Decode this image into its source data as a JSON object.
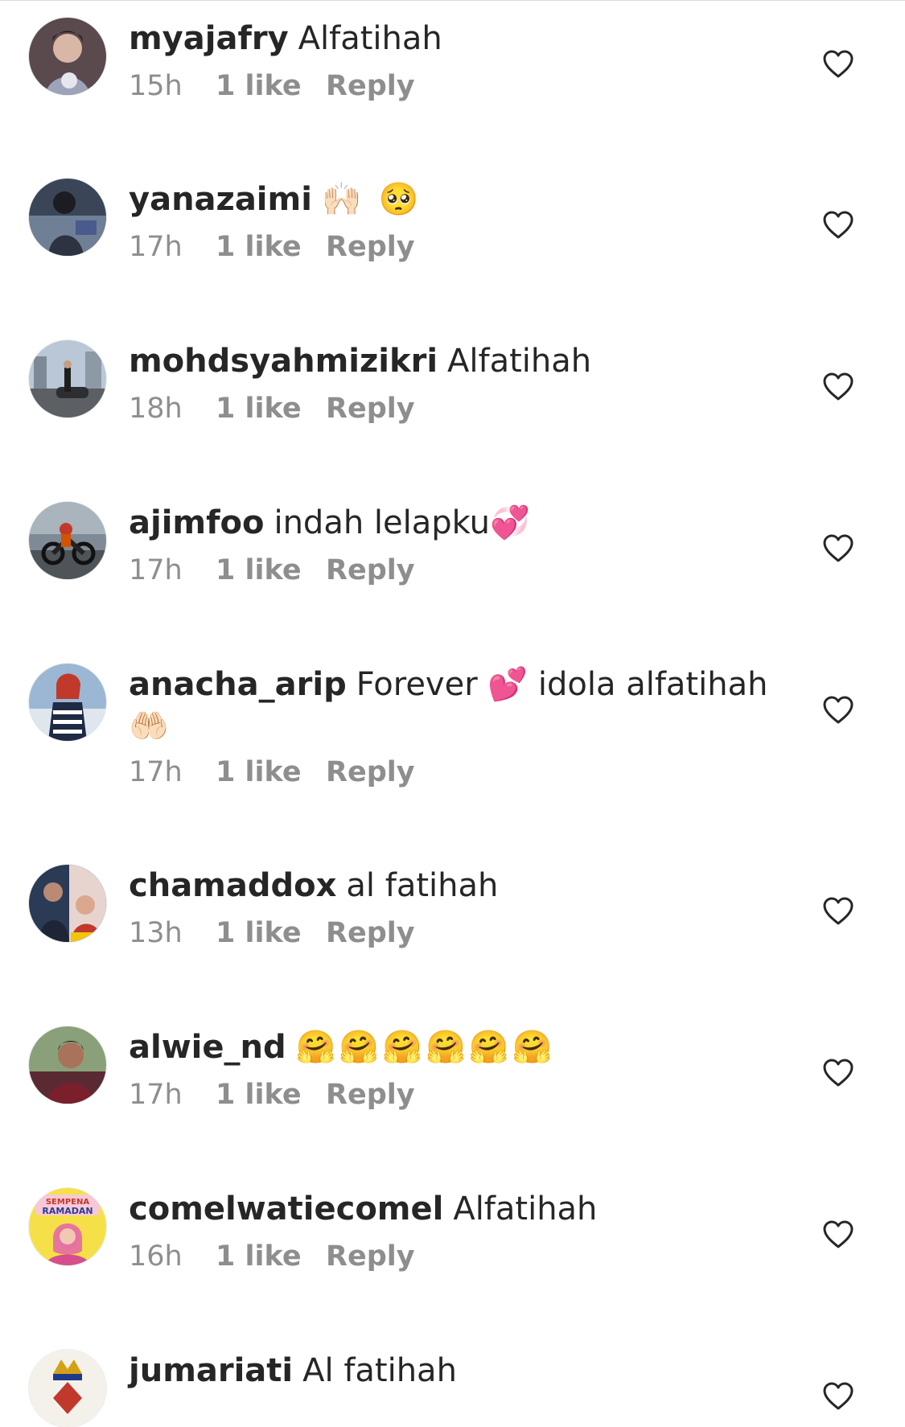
{
  "comments": [
    {
      "username": "myajafry",
      "text": "Alfatihah",
      "emoji": "",
      "time": "15h",
      "likes": "1 like",
      "reply": "Reply"
    },
    {
      "username": "yanazaimi",
      "text": "",
      "emoji": "🙌🏻 🥺",
      "time": "17h",
      "likes": "1 like",
      "reply": "Reply"
    },
    {
      "username": "mohdsyahmizikri",
      "text": "Alfatihah",
      "emoji": "",
      "time": "18h",
      "likes": "1 like",
      "reply": "Reply"
    },
    {
      "username": "ajimfoo",
      "text": "indah lelapku",
      "emoji": "💞",
      "time": "17h",
      "likes": "1 like",
      "reply": "Reply"
    },
    {
      "username": "anacha_arip",
      "text": "Forever 💕 idola alfatihah",
      "emoji": "🤲🏻",
      "time": "17h",
      "likes": "1 like",
      "reply": "Reply"
    },
    {
      "username": "chamaddox",
      "text": "al fatihah",
      "emoji": "",
      "time": "13h",
      "likes": "1 like",
      "reply": "Reply"
    },
    {
      "username": "alwie_nd",
      "text": "",
      "emoji": "🤗🤗🤗🤗🤗🤗",
      "time": "17h",
      "likes": "1 like",
      "reply": "Reply"
    },
    {
      "username": "comelwatiecomel",
      "text": "Alfatihah",
      "emoji": "",
      "time": "16h",
      "likes": "1 like",
      "reply": "Reply"
    },
    {
      "username": "jumariati",
      "text": "Al fatihah",
      "emoji": "",
      "time": "",
      "likes": "",
      "reply": ""
    }
  ],
  "avatar_badge_text": {
    "line1": "SEMPENA",
    "line2": "RAMADAN"
  },
  "colors": {
    "text": "#262626",
    "meta": "#8e8e8e",
    "divider": "#dbdbdb",
    "heart_outline": "#262626"
  },
  "icons": {
    "like": "heart-outline-icon"
  }
}
